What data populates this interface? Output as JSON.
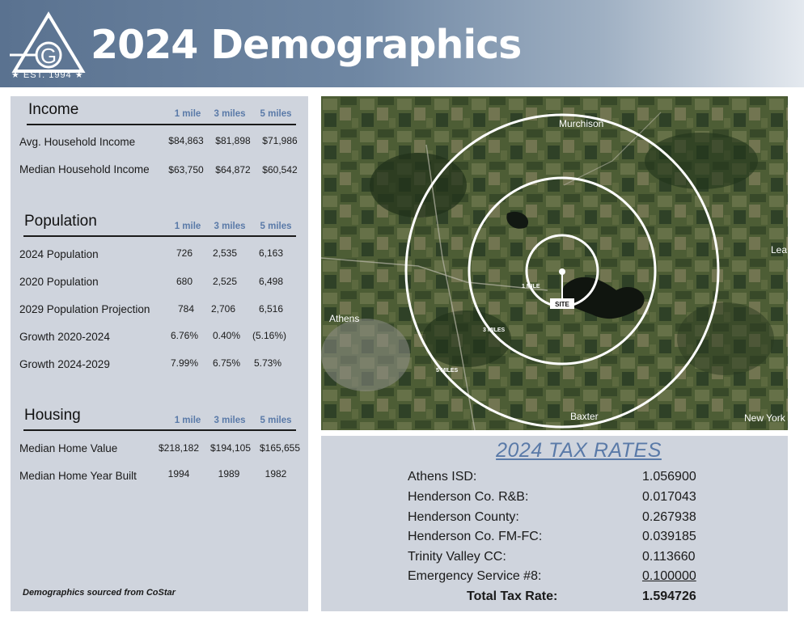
{
  "header": {
    "title": "2024 Demographics",
    "logo_letters": "AG",
    "logo_est": "★ EST. 1994 ★"
  },
  "columns": [
    "1 mile",
    "3 miles",
    "5 miles"
  ],
  "income": {
    "title": "Income",
    "rows": [
      {
        "label": "Avg. Household Income",
        "values": [
          "$84,863",
          "$81,898",
          "$71,986"
        ]
      },
      {
        "label": "Median Household Income",
        "values": [
          "$63,750",
          "$64,872",
          "$60,542"
        ]
      }
    ]
  },
  "population": {
    "title": "Population",
    "rows": [
      {
        "label": "2024 Population",
        "values": [
          "726",
          "2,535",
          "6,163"
        ]
      },
      {
        "label": "2020 Population",
        "values": [
          "680",
          "2,525",
          "6,498"
        ]
      },
      {
        "label": "2029 Population Projection",
        "values": [
          "784",
          "2,706",
          "6,516"
        ]
      },
      {
        "label": "Growth 2020-2024",
        "values": [
          "6.76%",
          "0.40%",
          "(5.16%)"
        ]
      },
      {
        "label": "Growth 2024-2029",
        "values": [
          "7.99%",
          "6.75%",
          "5.73%"
        ]
      }
    ]
  },
  "housing": {
    "title": "Housing",
    "rows": [
      {
        "label": "Median Home Value",
        "values": [
          "$218,182",
          "$194,105",
          "$165,655"
        ]
      },
      {
        "label": "Median Home Year Built",
        "values": [
          "1994",
          "1989",
          "1982"
        ]
      }
    ]
  },
  "source": {
    "prefix": "Demographics sourced from ",
    "brand": "CoStar"
  },
  "map": {
    "labels": {
      "murchison": "Murchison",
      "athens": "Athens",
      "baxter": "Baxter",
      "new_york": "New York",
      "lea": "Lea",
      "site": "SITE",
      "ring1": "1 MILE",
      "ring3": "3 MILES",
      "ring5": "5 MILES"
    }
  },
  "tax": {
    "title": "2024 TAX RATES",
    "rows": [
      {
        "label": "Athens ISD:",
        "value": "1.056900"
      },
      {
        "label": "Henderson Co. R&B:",
        "value": "0.017043"
      },
      {
        "label": "Henderson County:",
        "value": "0.267938"
      },
      {
        "label": "Henderson Co. FM-FC:",
        "value": "0.039185"
      },
      {
        "label": "Trinity Valley CC:",
        "value": "0.113660"
      },
      {
        "label": "Emergency Service #8:",
        "value": "0.100000"
      }
    ],
    "total_label": "Total Tax Rate:",
    "total_value": "1.594726"
  },
  "colors": {
    "header_blue": "#5a7290",
    "panel_gray": "#cfd4dd",
    "accent_blue": "#5a7aa8"
  }
}
